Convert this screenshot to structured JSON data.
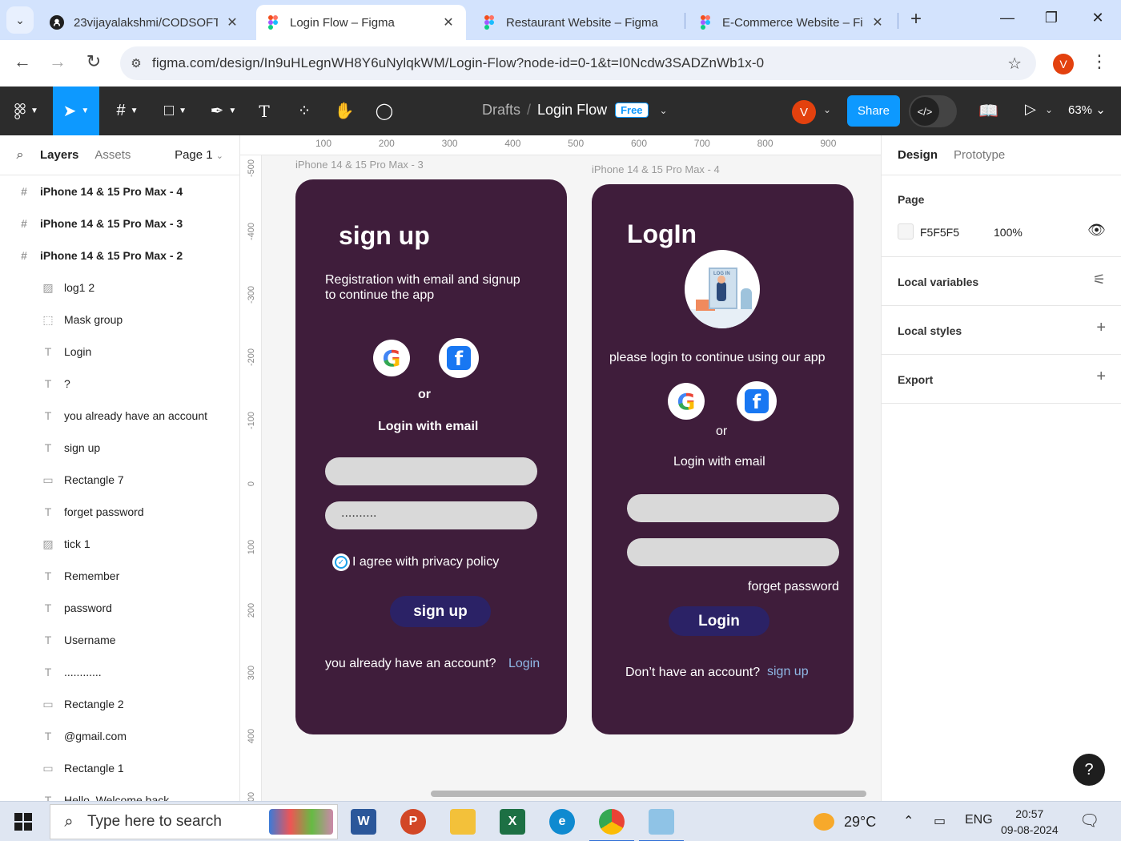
{
  "browser": {
    "tabs": [
      {
        "title": "23vijayalakshmi/CODSOFT",
        "icon": "github-icon"
      },
      {
        "title": "Login Flow – Figma",
        "icon": "figma-icon"
      },
      {
        "title": "Restaurant Website – Figma",
        "icon": "figma-icon"
      },
      {
        "title": "E-Commerce Website – Figma",
        "icon": "figma-icon"
      }
    ],
    "url": "figma.com/design/In9uHLegnWH8Y6uNylqkWM/Login-Flow?node-id=0-1&t=I0Ncdw3SADZnWb1x-0",
    "profile_initial": "V"
  },
  "figma": {
    "breadcrumb_drafts": "Drafts",
    "breadcrumb_sep": "/",
    "file_name": "Login Flow",
    "plan_badge": "Free",
    "avatar_initial": "V",
    "share_label": "Share",
    "zoom": "63%"
  },
  "layers_panel": {
    "tab_layers": "Layers",
    "tab_assets": "Assets",
    "page_selector": "Page 1",
    "items": [
      {
        "name": "iPhone 14 & 15 Pro Max - 4",
        "type": "frame"
      },
      {
        "name": "iPhone 14 & 15 Pro Max - 3",
        "type": "frame"
      },
      {
        "name": "iPhone 14 & 15 Pro Max - 2",
        "type": "frame"
      },
      {
        "name": "log1 2",
        "type": "image"
      },
      {
        "name": "Mask group",
        "type": "mask"
      },
      {
        "name": "Login",
        "type": "text"
      },
      {
        "name": "?",
        "type": "text"
      },
      {
        "name": "you already have an account",
        "type": "text"
      },
      {
        "name": "sign up",
        "type": "text"
      },
      {
        "name": "Rectangle 7",
        "type": "rect"
      },
      {
        "name": "forget password",
        "type": "text"
      },
      {
        "name": "tick 1",
        "type": "image"
      },
      {
        "name": "Remember",
        "type": "text"
      },
      {
        "name": "password",
        "type": "text"
      },
      {
        "name": "Username",
        "type": "text"
      },
      {
        "name": "............",
        "type": "text"
      },
      {
        "name": "Rectangle 2",
        "type": "rect"
      },
      {
        "name": "@gmail.com",
        "type": "text"
      },
      {
        "name": "Rectangle 1",
        "type": "rect"
      },
      {
        "name": "Hello, Welcome back",
        "type": "text"
      }
    ]
  },
  "canvas": {
    "ruler_top": [
      "100",
      "200",
      "300",
      "400",
      "500",
      "600",
      "700",
      "800",
      "900"
    ],
    "ruler_left": [
      "-500",
      "-400",
      "-300",
      "-200",
      "-100",
      "0",
      "100",
      "200",
      "300",
      "400",
      "500"
    ],
    "signup_frame": {
      "label": "iPhone 14 & 15 Pro Max - 3",
      "title": "sign up",
      "subtitle_line1": "Registration with email  and signup",
      "subtitle_line2": "to continue the app",
      "or_text": "or",
      "email_heading": "Login with email",
      "password_value": "..........",
      "agree_text": "I agree with privacy policy",
      "button_label": "sign up",
      "footer_text": "you already have an account?",
      "footer_link": "Login"
    },
    "login_frame": {
      "label": "iPhone 14 & 15 Pro Max - 4",
      "title": "LogIn",
      "illustration_text": "LOG IN",
      "subtitle": "please login to continue using our app",
      "or_text": "or",
      "email_heading": "Login with email",
      "forget_password": "forget password",
      "button_label": "Login",
      "footer_text": "Don’t have an account?",
      "footer_link": "sign up"
    }
  },
  "design_panel": {
    "tab_design": "Design",
    "tab_prototype": "Prototype",
    "page_heading": "Page",
    "page_color": "F5F5F5",
    "page_opacity": "100%",
    "local_variables": "Local variables",
    "local_styles": "Local styles",
    "export": "Export",
    "help": "?"
  },
  "taskbar": {
    "search_placeholder": "Type here to search",
    "temperature": "29°C",
    "language": "ENG",
    "time": "20:57",
    "date": "09-08-2024"
  },
  "colors": {
    "frame_bg": "#3f1d3b",
    "button_bg": "#2b2266",
    "figma_accent": "#0d99ff",
    "link": "#8fb8e6"
  }
}
